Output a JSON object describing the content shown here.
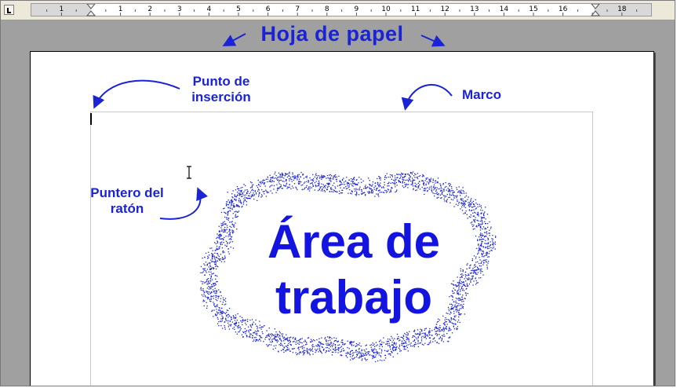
{
  "ruler": {
    "labels": [
      "1",
      "1",
      "2",
      "3",
      "4",
      "5",
      "6",
      "7",
      "8",
      "9",
      "10",
      "11",
      "12",
      "13",
      "14",
      "15",
      "16",
      "18"
    ]
  },
  "annotations": {
    "title": "Hoja de papel",
    "insertion_point": "Punto de inserción",
    "frame": "Marco",
    "mouse_pointer": "Puntero del ratón",
    "work_area": "Área de trabajo"
  },
  "colors": {
    "annotation": "#1a23d6",
    "work_area_text": "#1414e0",
    "speckle": "#1a23d6",
    "background": "#a0a0a0"
  },
  "icons": {
    "tab_selector": "tab-stop-left-icon",
    "first_line_indent": "indent-hourglass-icon",
    "right_indent": "right-indent-icon",
    "mouse_cursor": "i-beam-cursor-icon",
    "insertion_caret": "text-caret-icon"
  }
}
